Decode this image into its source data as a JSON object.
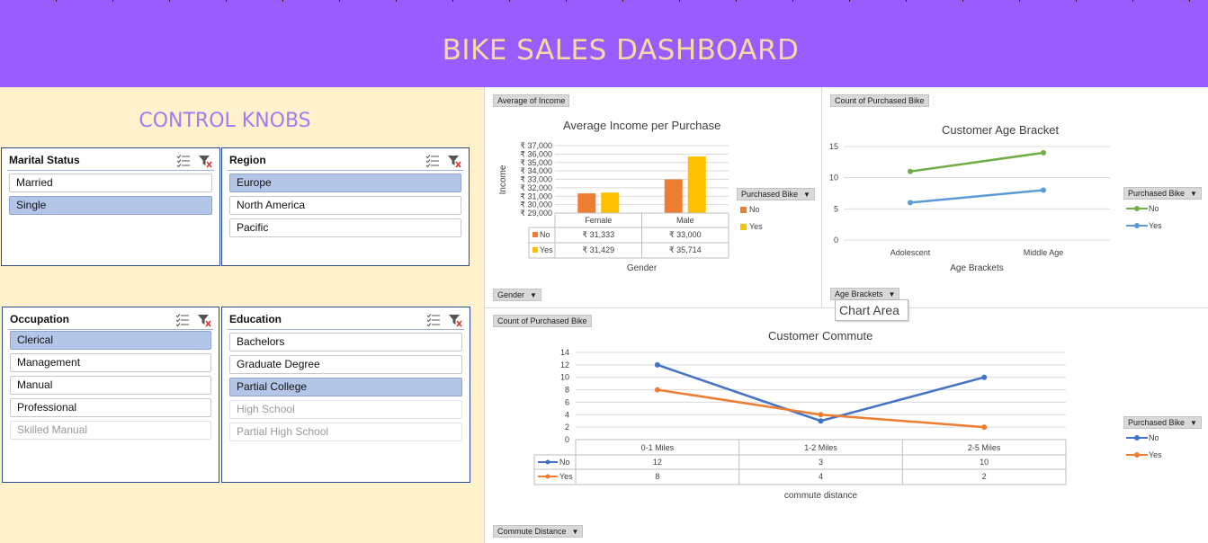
{
  "header": {
    "title": "BIKE SALES DASHBOARD"
  },
  "control": {
    "title": "CONTROL KNOBS"
  },
  "colors": {
    "header": "#9a5cff",
    "title": "#f7d9a3",
    "panel": "#fff2cc",
    "selected": "#b4c6e7",
    "orange": "#ed7d31",
    "gold": "#ffc000",
    "blue": "#4472c4",
    "green": "#70ad47",
    "lightblue": "#5b9bd5"
  },
  "slicers": {
    "marital": {
      "title": "Marital Status",
      "items": [
        {
          "label": "Married",
          "state": "normal"
        },
        {
          "label": "Single",
          "state": "selected"
        }
      ]
    },
    "region": {
      "title": "Region",
      "items": [
        {
          "label": "Europe",
          "state": "selected"
        },
        {
          "label": "North America",
          "state": "normal"
        },
        {
          "label": "Pacific",
          "state": "normal"
        }
      ]
    },
    "occupation": {
      "title": "Occupation",
      "items": [
        {
          "label": "Clerical",
          "state": "selected"
        },
        {
          "label": "Management",
          "state": "normal"
        },
        {
          "label": "Manual",
          "state": "normal"
        },
        {
          "label": "Professional",
          "state": "normal"
        },
        {
          "label": "Skilled Manual",
          "state": "dim"
        }
      ]
    },
    "education": {
      "title": "Education",
      "items": [
        {
          "label": "Bachelors",
          "state": "normal"
        },
        {
          "label": "Graduate Degree",
          "state": "normal"
        },
        {
          "label": "Partial College",
          "state": "selected"
        },
        {
          "label": "High School",
          "state": "dim"
        },
        {
          "label": "Partial High School",
          "state": "dim"
        }
      ]
    }
  },
  "fields": {
    "income_value": "Average of Income",
    "income_axis": "Gender",
    "age_value": "Count of Purchased Bike",
    "age_axis": "Age Brackets",
    "commute_value": "Count of Purchased Bike",
    "commute_axis": "Commute Distance",
    "legend_field": "Purchased Bike"
  },
  "tooltip": "Chart Area",
  "chart_data": [
    {
      "type": "bar",
      "title": "Average Income per Purchase",
      "xlabel": "Gender",
      "ylabel": "Income",
      "categories": [
        "Female",
        "Male"
      ],
      "ylim": [
        29000,
        37000
      ],
      "yticks": [
        "₹ 37,000",
        "₹ 36,000",
        "₹ 35,000",
        "₹ 34,000",
        "₹ 33,000",
        "₹ 32,000",
        "₹ 31,000",
        "₹ 30,000",
        "₹ 29,000"
      ],
      "legend_title": "Purchased Bike",
      "series": [
        {
          "name": "No",
          "values": [
            31333,
            33000
          ],
          "labels": [
            "₹ 31,333",
            "₹ 33,000"
          ]
        },
        {
          "name": "Yes",
          "values": [
            31429,
            35714
          ],
          "labels": [
            "₹ 31,429",
            "₹ 35,714"
          ]
        }
      ]
    },
    {
      "type": "line",
      "title": "Customer Age Bracket",
      "xlabel": "Age Brackets",
      "categories": [
        "Adolescent",
        "Middle Age"
      ],
      "ylim": [
        0,
        15
      ],
      "yticks": [
        "15",
        "10",
        "5",
        "0"
      ],
      "legend_title": "Purchased Bike",
      "series": [
        {
          "name": "No",
          "values": [
            11,
            14
          ]
        },
        {
          "name": "Yes",
          "values": [
            6,
            8
          ]
        }
      ]
    },
    {
      "type": "line",
      "title": "Customer Commute",
      "xlabel": "commute distance",
      "categories": [
        "0-1 Miles",
        "1-2 Miles",
        "2-5 Miles"
      ],
      "ylim": [
        0,
        14
      ],
      "yticks": [
        "14",
        "12",
        "10",
        "8",
        "6",
        "4",
        "2",
        "0"
      ],
      "legend_title": "Purchased Bike",
      "series": [
        {
          "name": "No",
          "values": [
            12,
            3,
            10
          ]
        },
        {
          "name": "Yes",
          "values": [
            8,
            4,
            2
          ]
        }
      ]
    }
  ]
}
